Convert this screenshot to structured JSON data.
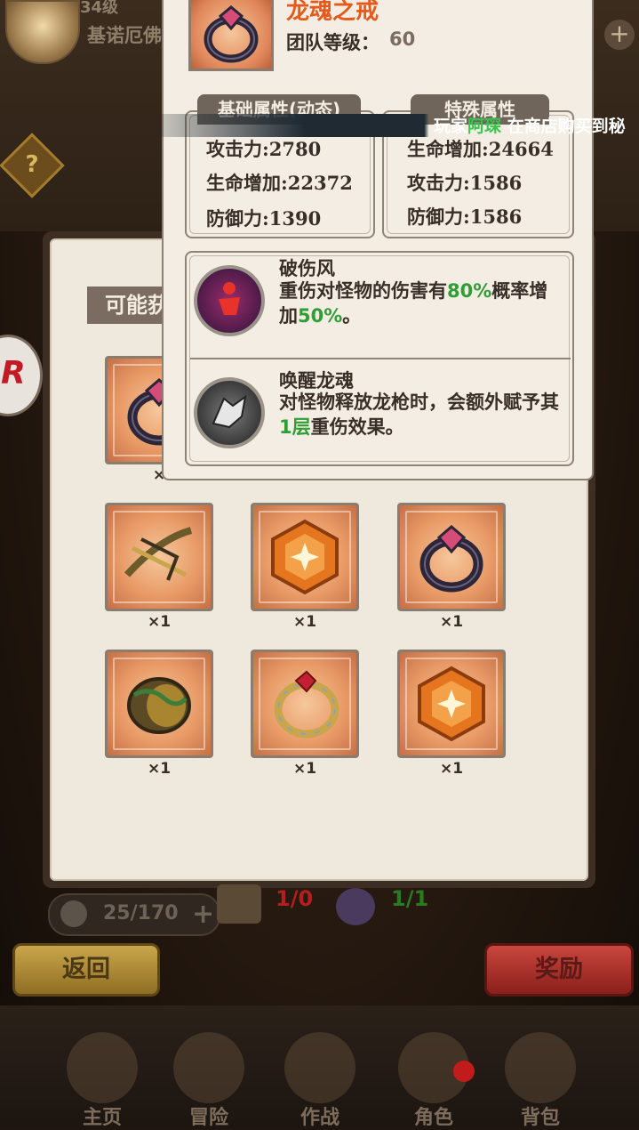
{
  "header": {
    "level": "34级",
    "player_name": "基诺厄佛"
  },
  "marquee": {
    "prefix": "玩家",
    "player": "阿琛",
    "suffix": "在商店购买到秘"
  },
  "tooltip": {
    "item_name": "龙魂之戒",
    "level_label": "团队等级：",
    "level_value": "60",
    "basic_header": "基础属性(动态)",
    "special_header": "特殊属性",
    "basic_stats": [
      "攻击力:2780",
      "生命增加:22372",
      "防御力:1390"
    ],
    "special_stats": [
      "生命增加:24664",
      "攻击力:1586",
      "防御力:1586"
    ],
    "skills": [
      {
        "title": "破伤风",
        "desc_1": "重伤对怪物的伤害有",
        "hl_1": "80%",
        "desc_2": "概率增加",
        "hl_2": "50%",
        "desc_3": "。"
      },
      {
        "title": "唤醒龙魂",
        "desc_1": "对怪物释放龙枪时，会额外赋予其",
        "hl_1": "1层",
        "desc_2": "重伤效果。"
      }
    ]
  },
  "panel": {
    "section_tab": "可能获"
  },
  "items": [
    {
      "icon": "dark-ruby-ring-icon",
      "count": "×"
    },
    {
      "icon": "dragon-crossbow-icon",
      "count": "×1"
    },
    {
      "icon": "orange-gem-icon",
      "count": "×1"
    },
    {
      "icon": "dark-ruby-ring-icon",
      "count": "×1"
    },
    {
      "icon": "jade-serpent-ring-icon",
      "count": "×1"
    },
    {
      "icon": "golden-ruby-ring-icon",
      "count": "×1"
    },
    {
      "icon": "orange-gem-icon",
      "count": "×1"
    }
  ],
  "resources": {
    "stamina": "25/170",
    "key_count": "1/0",
    "potion_count": "1/1"
  },
  "buttons": {
    "back": "返回",
    "reward": "奖励"
  },
  "nav": [
    "主页",
    "冒险",
    "作战",
    "角色",
    "背包"
  ],
  "colors": {
    "item_name": "#e55a1b",
    "highlight": "#2f9e35",
    "key_count": "#b51e1e",
    "potion_count": "#2c7a20"
  }
}
